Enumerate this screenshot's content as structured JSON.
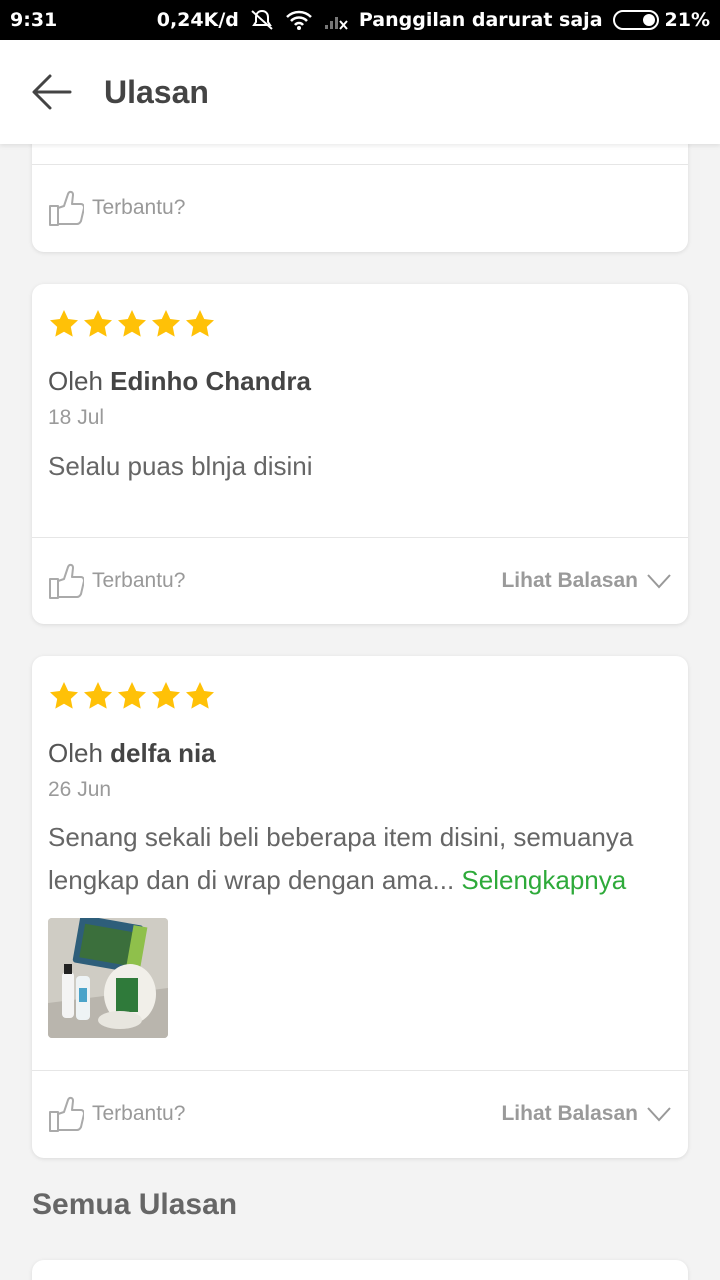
{
  "status_bar": {
    "time": "9:31",
    "net_speed": "0,24K/d",
    "carrier": "Panggilan darurat saja",
    "battery": "21%"
  },
  "app_bar": {
    "title": "Ulasan",
    "back_icon": "arrow-left-icon"
  },
  "top_card": {
    "helpful_label": "Terbantu?"
  },
  "reviews": [
    {
      "rating": 5,
      "by_prefix": "Oleh ",
      "reviewer": "Edinho Chandra",
      "date": "18 Jul",
      "text": "Selalu puas blnja disini",
      "helpful_label": "Terbantu?",
      "see_replies_label": "Lihat Balasan"
    },
    {
      "rating": 5,
      "by_prefix": "Oleh ",
      "reviewer": "delfa nia",
      "date": "26 Jun",
      "text": "Senang sekali beli beberapa item disini, semuanya lengkap dan di wrap dengan ama...",
      "more_label": "Selengkapnya",
      "helpful_label": "Terbantu?",
      "see_replies_label": "Lihat Balasan"
    }
  ],
  "section": {
    "all_reviews_title": "Semua Ulasan"
  },
  "colors": {
    "star": "#ffc107",
    "link_green": "#2eaa3a"
  }
}
